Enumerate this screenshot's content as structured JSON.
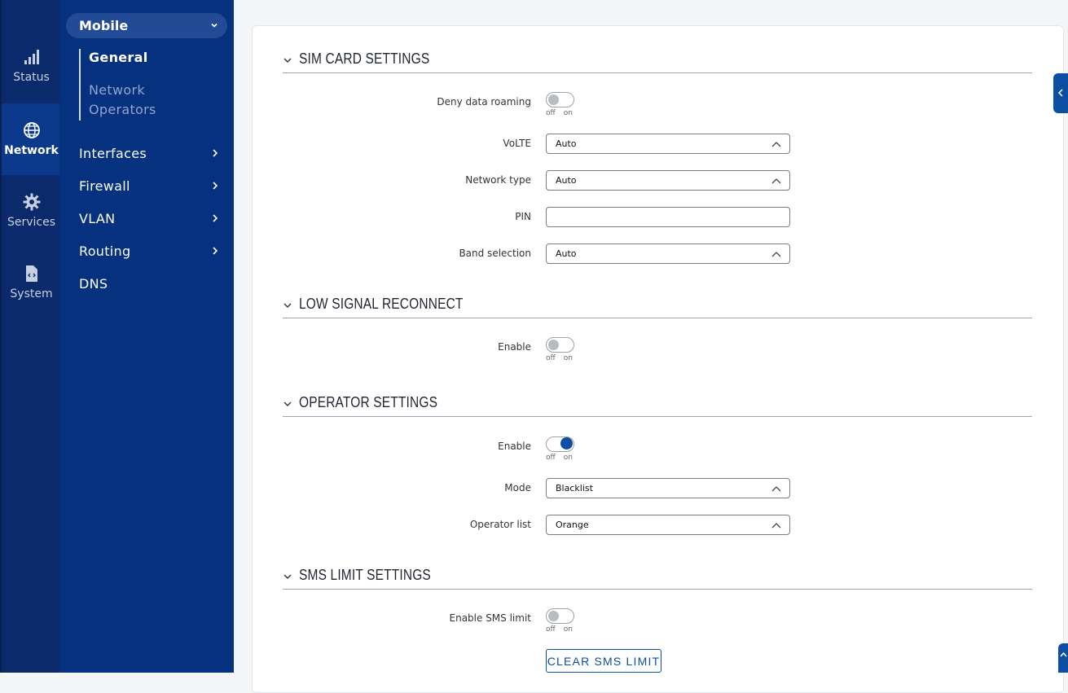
{
  "rail": {
    "items": [
      {
        "label": "Status",
        "icon": "signal-bars-icon"
      },
      {
        "label": "Network",
        "icon": "globe-icon",
        "active": true
      },
      {
        "label": "Services",
        "icon": "gear-icon"
      },
      {
        "label": "System",
        "icon": "file-code-icon"
      }
    ]
  },
  "subnav": {
    "group": "Mobile",
    "sublinks": [
      "General",
      "Network\nOperators"
    ],
    "items": [
      "Interfaces",
      "Firewall",
      "VLAN",
      "Routing",
      "DNS"
    ]
  },
  "sections": {
    "sim": {
      "title": "SIM CARD SETTINGS",
      "deny_roaming_label": "Deny data roaming",
      "volte_label": "VoLTE",
      "volte_value": "Auto",
      "network_type_label": "Network type",
      "network_type_value": "Auto",
      "pin_label": "PIN",
      "pin_value": "",
      "band_label": "Band selection",
      "band_value": "Auto"
    },
    "low_signal": {
      "title": "LOW SIGNAL RECONNECT",
      "enable_label": "Enable"
    },
    "operator": {
      "title": "OPERATOR SETTINGS",
      "enable_label": "Enable",
      "mode_label": "Mode",
      "mode_value": "Blacklist",
      "list_label": "Operator list",
      "list_value": "Orange"
    },
    "sms": {
      "title": "SMS LIMIT SETTINGS",
      "enable_label": "Enable SMS limit",
      "clear_button": "CLEAR SMS LIMIT"
    }
  },
  "toggle_text": {
    "off": "off",
    "on": "on"
  },
  "toggles": {
    "deny_roaming": false,
    "low_signal": false,
    "operator": true,
    "sms_limit": false
  },
  "colors": {
    "rail_bg": "#0b2a6b",
    "subnav_bg": "#05317f",
    "accent": "#0b4ea2"
  }
}
